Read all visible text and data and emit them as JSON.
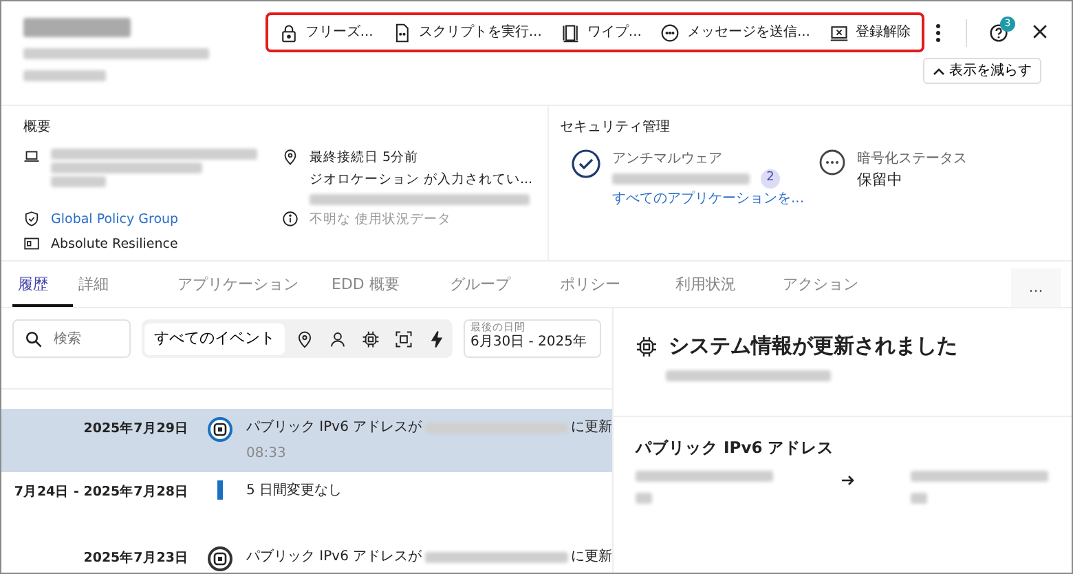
{
  "toolbar": {
    "actions": [
      {
        "label": "フリーズ..."
      },
      {
        "label": "スクリプトを実行..."
      },
      {
        "label": "ワイプ..."
      },
      {
        "label": "メッセージを送信..."
      },
      {
        "label": "登録解除"
      }
    ],
    "help_badge": "3"
  },
  "collapse_button": "表示を減らす",
  "overview": {
    "title": "概要",
    "last_connected": "最終接続日 5分前",
    "geolocation": "ジオロケーション が入力されてい...",
    "policy_group": "Global Policy Group",
    "usage": "不明な 使用状況データ",
    "resilience": "Absolute Resilience"
  },
  "security": {
    "title": "セキュリティ管理",
    "antimalware": {
      "label": "アンチマルウェア",
      "count": "2",
      "link": "すべてのアプリケーションを..."
    },
    "encryption": {
      "label": "暗号化ステータス",
      "value": "保留中"
    }
  },
  "tabs": [
    {
      "label": "履歴",
      "selected": true
    },
    {
      "label": "詳細",
      "selected": false
    },
    {
      "label": "アプリケーション",
      "selected": false
    },
    {
      "label": "EDD 概要",
      "selected": false
    },
    {
      "label": "グループ",
      "selected": false
    },
    {
      "label": "ポリシー",
      "selected": false
    },
    {
      "label": "利用状況",
      "selected": false
    },
    {
      "label": "アクション",
      "selected": false
    }
  ],
  "more_tabs": "...",
  "search": {
    "placeholder": "検索"
  },
  "filters": [
    {
      "label": "すべてのイベント",
      "selected": true
    }
  ],
  "date_range": {
    "label": "最後の日間",
    "value": "6月30日 - 2025年"
  },
  "timeline": [
    {
      "kind": "event",
      "date": "2025年7月29日",
      "text": "パブリック IPv6 アドレスが",
      "suffix": "に更新",
      "time": "08:33",
      "selected": true
    },
    {
      "kind": "gap",
      "date": "7月24日 - 2025年7月28日",
      "text": "5 日間変更なし",
      "selected": false
    },
    {
      "kind": "event",
      "date": "2025年7月23日",
      "text": "パブリック IPv6 アドレスが",
      "suffix": "に更新",
      "selected": false
    }
  ],
  "detail": {
    "title": "システム情報が更新されました",
    "section": "パブリック IPv6 アドレス"
  }
}
